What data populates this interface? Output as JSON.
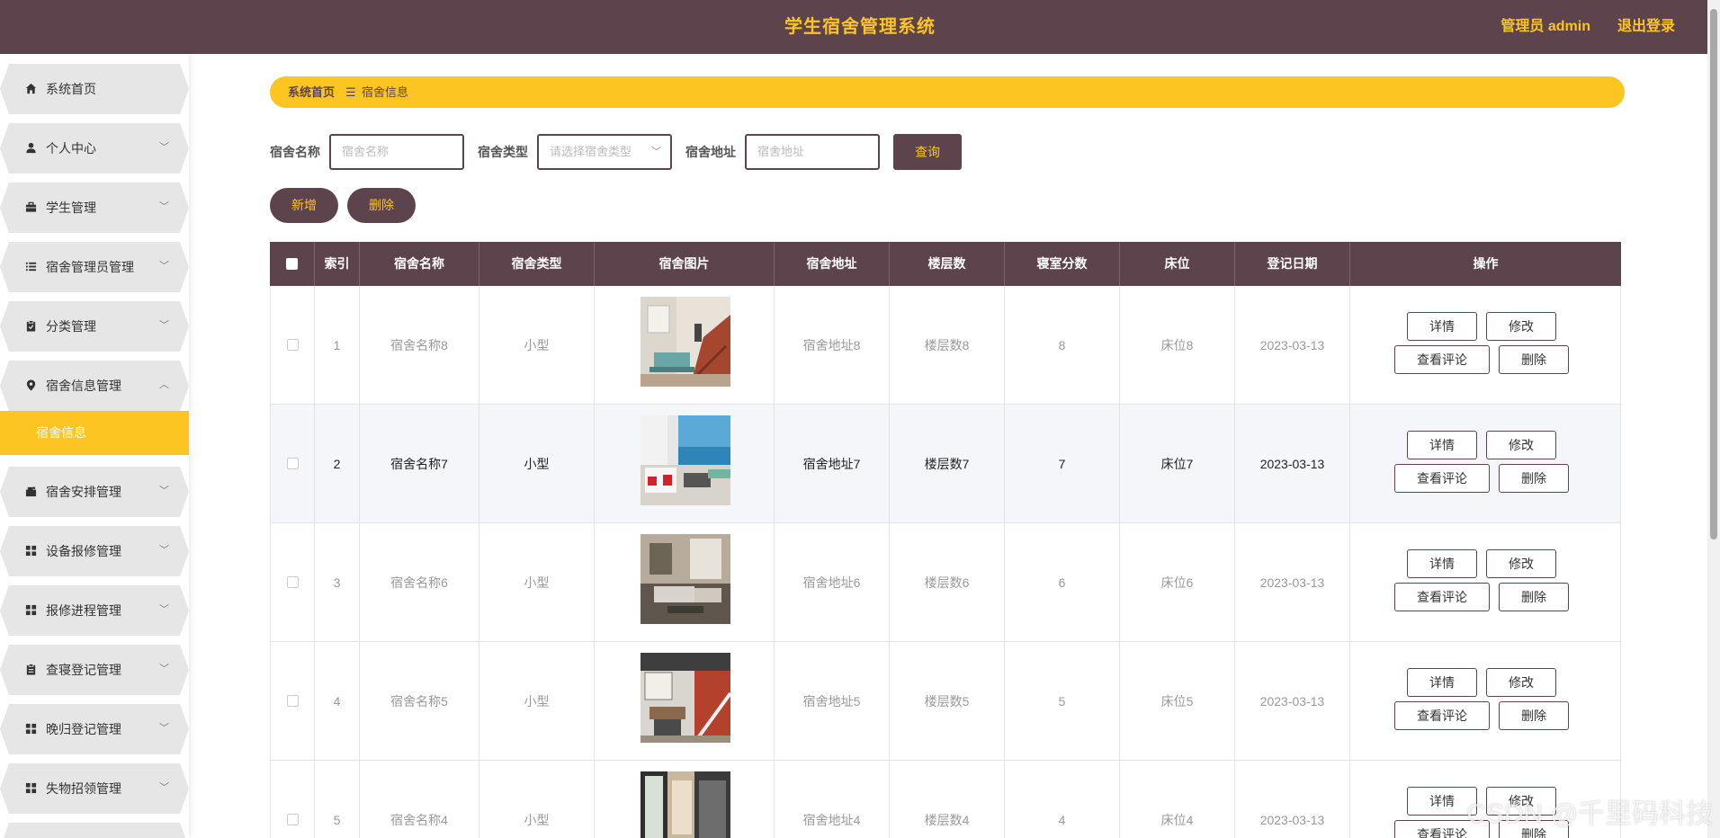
{
  "header": {
    "title": "学生宿舍管理系统",
    "admin_label": "管理员 admin",
    "logout_label": "退出登录"
  },
  "sidebar": {
    "items": [
      {
        "label": "系统首页",
        "icon": "home-icon",
        "arrow": ""
      },
      {
        "label": "个人中心",
        "icon": "user-icon",
        "arrow": "﹀"
      },
      {
        "label": "学生管理",
        "icon": "briefcase-icon",
        "arrow": "﹀"
      },
      {
        "label": "宿舍管理员管理",
        "icon": "list-icon",
        "arrow": "﹀"
      },
      {
        "label": "分类管理",
        "icon": "clipboard-icon",
        "arrow": "﹀"
      },
      {
        "label": "宿舍信息管理",
        "icon": "pin-icon",
        "arrow": "︿"
      },
      {
        "label": "宿舍安排管理",
        "icon": "tag-icon",
        "arrow": "﹀"
      },
      {
        "label": "设备报修管理",
        "icon": "grid-icon",
        "arrow": "﹀"
      },
      {
        "label": "报修进程管理",
        "icon": "grid-icon",
        "arrow": "﹀"
      },
      {
        "label": "查寝登记管理",
        "icon": "clipboard-icon",
        "arrow": "﹀"
      },
      {
        "label": "晚归登记管理",
        "icon": "grid-icon",
        "arrow": "﹀"
      },
      {
        "label": "失物招领管理",
        "icon": "grid-icon",
        "arrow": "﹀"
      }
    ],
    "active_sub": "宿舍信息"
  },
  "breadcrumb": {
    "home": "系统首页",
    "sep": "☰",
    "current": "宿舍信息"
  },
  "search": {
    "name_label": "宿舍名称",
    "name_placeholder": "宿舍名称",
    "type_label": "宿舍类型",
    "type_placeholder": "请选择宿舍类型",
    "addr_label": "宿舍地址",
    "addr_placeholder": "宿舍地址",
    "query_label": "查询"
  },
  "actions": {
    "add_label": "新增",
    "delete_label": "删除"
  },
  "table": {
    "headers": [
      "索引",
      "宿舍名称",
      "宿舍类型",
      "宿舍图片",
      "宿舍地址",
      "楼层数",
      "寝室分数",
      "床位",
      "登记日期",
      "操作"
    ],
    "row_buttons": {
      "detail": "详情",
      "edit": "修改",
      "comments": "查看评论",
      "delete": "删除"
    },
    "rows": [
      {
        "index": "1",
        "name": "宿舍名称8",
        "type": "小型",
        "address": "宿舍地址8",
        "floors": "楼层数8",
        "score": "8",
        "bed": "床位8",
        "date": "2023-03-13"
      },
      {
        "index": "2",
        "name": "宿舍名称7",
        "type": "小型",
        "address": "宿舍地址7",
        "floors": "楼层数7",
        "score": "7",
        "bed": "床位7",
        "date": "2023-03-13"
      },
      {
        "index": "3",
        "name": "宿舍名称6",
        "type": "小型",
        "address": "宿舍地址6",
        "floors": "楼层数6",
        "score": "6",
        "bed": "床位6",
        "date": "2023-03-13"
      },
      {
        "index": "4",
        "name": "宿舍名称5",
        "type": "小型",
        "address": "宿舍地址5",
        "floors": "楼层数5",
        "score": "5",
        "bed": "床位5",
        "date": "2023-03-13"
      },
      {
        "index": "5",
        "name": "宿舍名称4",
        "type": "小型",
        "address": "宿舍地址4",
        "floors": "楼层数4",
        "score": "4",
        "bed": "床位4",
        "date": "2023-03-13"
      }
    ]
  },
  "watermark": "CSDN @千里码科技",
  "colors": {
    "primary": "#5c434c",
    "accent": "#fcc521",
    "menu_bg": "#e6e6e6"
  }
}
